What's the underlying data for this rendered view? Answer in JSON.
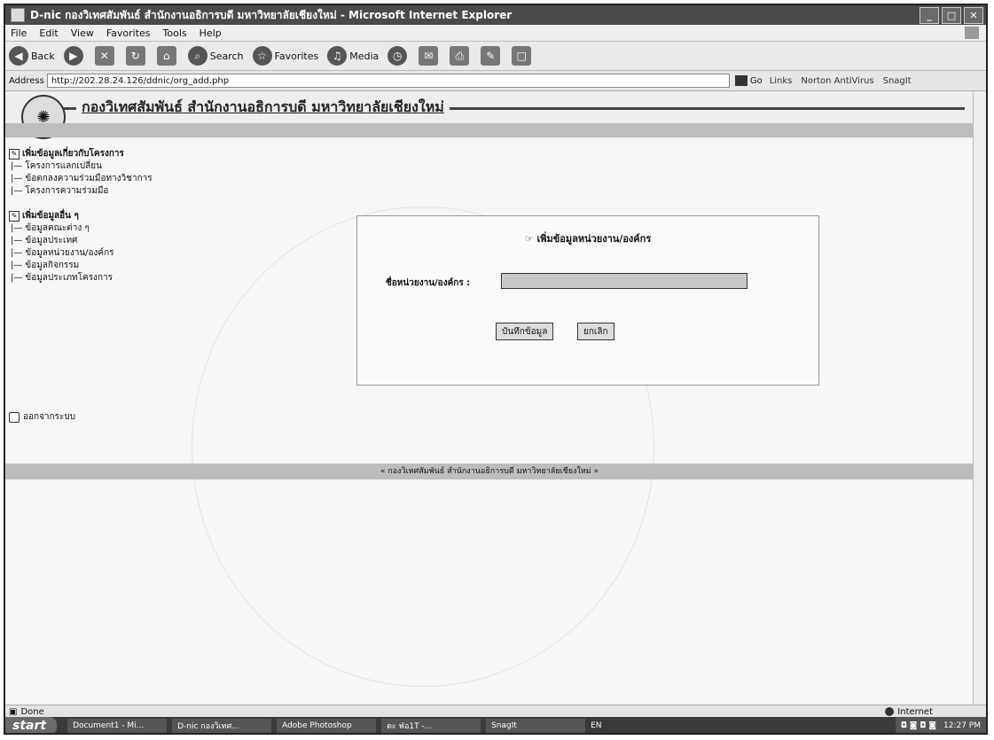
{
  "window": {
    "title": "D-nic กองวิเทศสัมพันธ์ สำนักงานอธิการบดี มหาวิทยาลัยเชียงใหม่ - Microsoft Internet Explorer"
  },
  "menu": [
    "File",
    "Edit",
    "View",
    "Favorites",
    "Tools",
    "Help"
  ],
  "toolbar": {
    "back": "Back",
    "search": "Search",
    "favorites": "Favorites",
    "media": "Media"
  },
  "address": {
    "label": "Address",
    "url": "http://202.28.24.126/ddnic/org_add.php",
    "go": "Go",
    "links": "Links",
    "norton": "Norton AntiVirus",
    "snagit": "SnagIt"
  },
  "page": {
    "banner_title": "กองวิเทศสัมพันธ์ สำนักงานอธิการบดี มหาวิทยาลัยเชียงใหม่",
    "sidebar": {
      "section1_title": "เพิ่มข้อมูลเกี่ยวกับโครงการ",
      "section1_items": [
        "โครงการแลกเปลี่ยน",
        "ข้อตกลงความร่วมมือทางวิชาการ",
        "โครงการความร่วมมือ"
      ],
      "section2_title": "เพิ่มข้อมูลอื่น ๆ",
      "section2_items": [
        "ข้อมูลคณะต่าง ๆ",
        "ข้อมูลประเทศ",
        "ข้อมูลหน่วยงาน/องค์กร",
        "ข้อมูลกิจกรรม",
        "ข้อมูลประเภทโครงการ"
      ],
      "logout": "ออกจากระบบ"
    },
    "form": {
      "title": "เพิ่มข้อมูลหน่วยงาน/องค์กร",
      "field_label": "ชื่อหน่วยงาน/องค์กร :",
      "field_value": "",
      "save_button": "บันทึกข้อมูล",
      "cancel_button": "ยกเลิก"
    },
    "footer": "« กองวิเทศสัมพันธ์ สำนักงานอธิการบดี มหาวิทยาลัยเชียงใหม่ »"
  },
  "status": {
    "left": "Done",
    "zone": "Internet"
  },
  "taskbar": {
    "start": "start",
    "tasks": [
      "Document1 - Mi...",
      "D-nic กองวิเทศ...",
      "Adobe Photoshop",
      "ตะ ฟ่อ1T -...",
      "SnagIt"
    ],
    "lang": "EN",
    "clock": "12:27 PM"
  }
}
